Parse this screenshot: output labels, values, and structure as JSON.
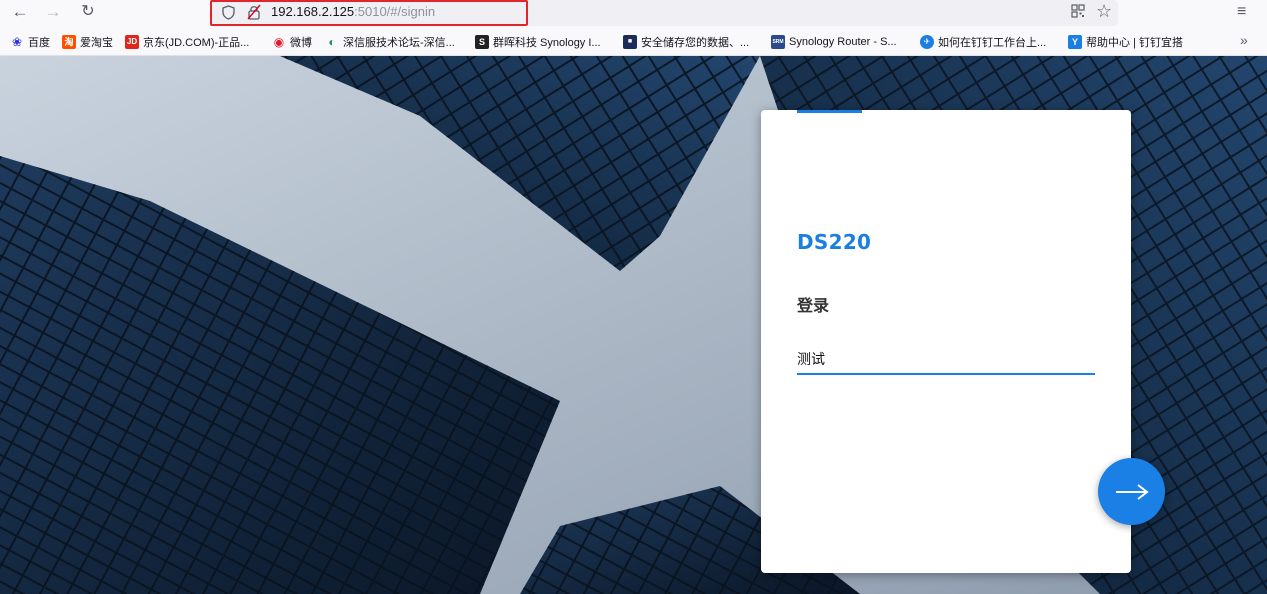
{
  "browser": {
    "url_host": "192.168.2.125",
    "url_path": ":5010/#/signin",
    "nav": {
      "back_icon": "←",
      "forward_icon": "→",
      "reload_icon": "↻"
    },
    "star_icon": "☆",
    "menu_icon": "≡",
    "more_icon": "»"
  },
  "bookmarks": [
    {
      "label": "百度",
      "icon": "paw-icon",
      "color": "#2932e1",
      "glyph": "❀"
    },
    {
      "label": "爱淘宝",
      "icon": "taobao-icon",
      "color": "#ff5000",
      "glyph": "淘"
    },
    {
      "label": "京东(JD.COM)-正品...",
      "icon": "jd-icon",
      "color": "#e1251b",
      "glyph": "JD"
    },
    {
      "label": "微博",
      "icon": "weibo-icon",
      "color": "#e6162d",
      "glyph": "◉"
    },
    {
      "label": "深信服技术论坛-深信...",
      "icon": "sangfor-icon",
      "color": "#1e8f5f",
      "glyph": "◐"
    },
    {
      "label": "群晖科技 Synology I...",
      "icon": "synology-icon",
      "color": "#222222",
      "glyph": "S"
    },
    {
      "label": "安全储存您的数据、...",
      "icon": "storage-icon",
      "color": "#1c2c5a",
      "glyph": "■"
    },
    {
      "label": "Synology Router - S...",
      "icon": "srm-icon",
      "color": "#2b4a8b",
      "glyph": "SRM"
    },
    {
      "label": "如何在钉钉工作台上...",
      "icon": "dingtalk-icon",
      "color": "#1a7fe0",
      "glyph": "✈"
    },
    {
      "label": "帮助中心 | 钉钉宜搭",
      "icon": "yida-icon",
      "color": "#1a7fe0",
      "glyph": "Y"
    }
  ],
  "login": {
    "device_name": "DS220",
    "title": "登录",
    "username_value": "测试",
    "next_icon": "arrow-right-icon"
  },
  "colors": {
    "accent": "#1a7fe0",
    "url_highlight": "#e0262b"
  }
}
